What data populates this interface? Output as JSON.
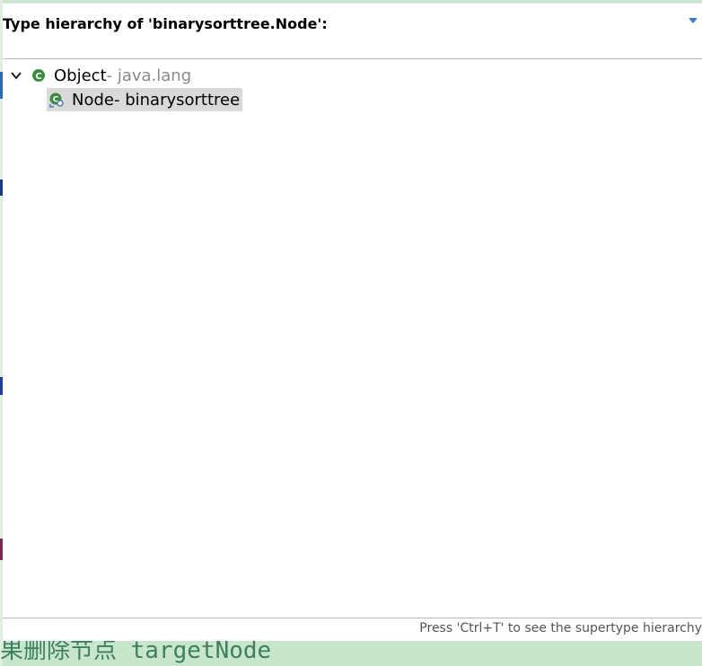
{
  "popup": {
    "title": "Type hierarchy of 'binarysorttree.Node':",
    "status_text": "Press 'Ctrl+T' to see the supertype hierarchy"
  },
  "tree": {
    "root": {
      "name": "Object",
      "package": " - java.lang",
      "icon": "class-icon",
      "expanded": true
    },
    "child": {
      "name": "Node",
      "package": " - binarysorttree",
      "icon": "class-icon",
      "selected": true
    }
  },
  "background": {
    "editor_text": "果删除节点 targetNode"
  },
  "colors": {
    "editor_background": "#c7e6cb",
    "selection": "#d9d9d9",
    "class_icon": "#3d8c40",
    "comment_text": "#3f7f5f"
  }
}
